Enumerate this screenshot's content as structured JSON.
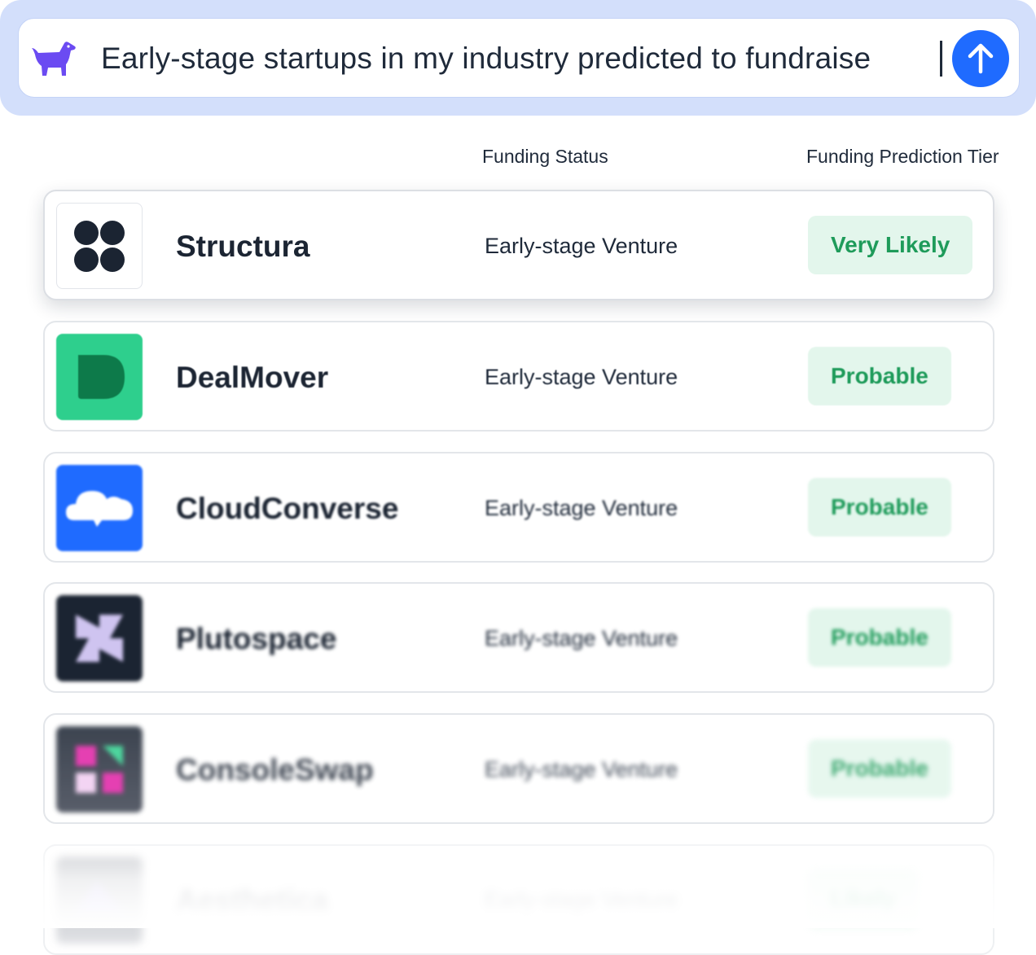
{
  "search": {
    "query": "Early-stage startups in my industry predicted to fundraise",
    "brand_icon": "dog-icon",
    "send_icon": "arrow-up-icon"
  },
  "columns": {
    "funding_status": "Funding Status",
    "funding_prediction_tier": "Funding Prediction Tier"
  },
  "companies": [
    {
      "name": "Structura",
      "status": "Early-stage Venture",
      "tier": "Very Likely",
      "logo": "four-dots-icon"
    },
    {
      "name": "DealMover",
      "status": "Early-stage Venture",
      "tier": "Probable",
      "logo": "letter-d-icon"
    },
    {
      "name": "CloudConverse",
      "status": "Early-stage Venture",
      "tier": "Probable",
      "logo": "cloud-chat-icon"
    },
    {
      "name": "Plutospace",
      "status": "Early-stage Venture",
      "tier": "Probable",
      "logo": "pinwheel-icon"
    },
    {
      "name": "ConsoleSwap",
      "status": "Early-stage Venture",
      "tier": "Probable",
      "logo": "blocks-icon"
    },
    {
      "name": "Aesthetica",
      "status": "Early-stage Venture",
      "tier": "Likely",
      "logo": "abstract-icon"
    }
  ],
  "colors": {
    "accent": "#1f6bff",
    "brand_purple": "#6b4bf2",
    "tier_text": "#1e9b5a",
    "tier_bg": "#e3f6ec"
  }
}
